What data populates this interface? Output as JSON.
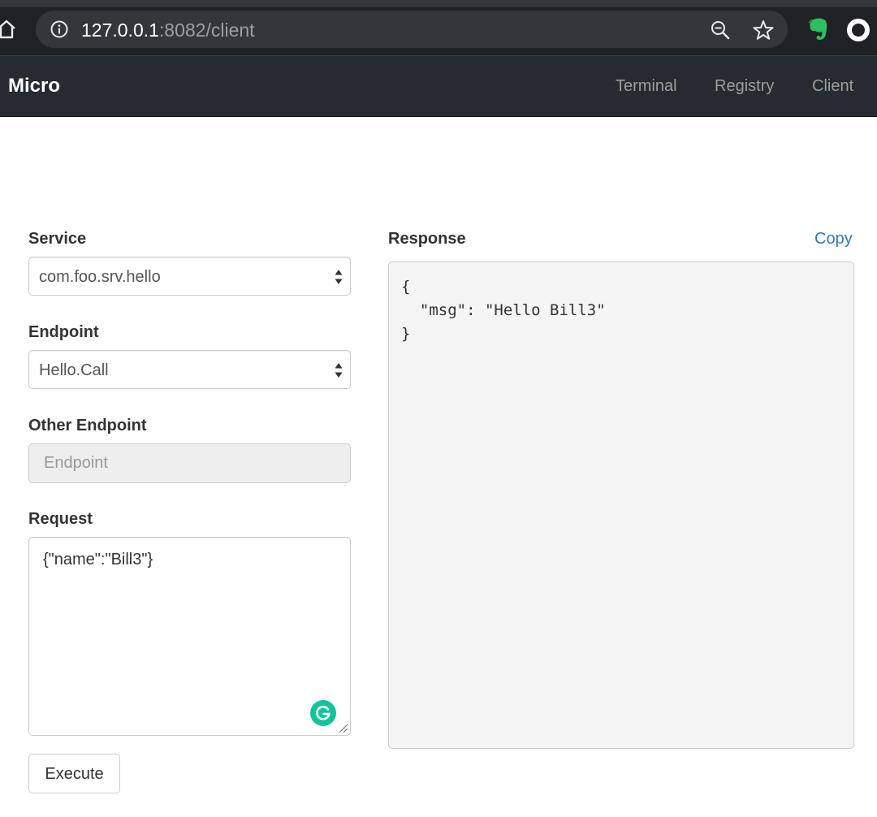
{
  "browser": {
    "url_host": "127.0.0.1",
    "url_rest": ":8082/client",
    "icons": [
      "home-icon",
      "info-icon",
      "zoom-out-icon",
      "star-icon",
      "evernote-icon",
      "opera-icon"
    ]
  },
  "navbar": {
    "brand": "Micro",
    "links": [
      "Terminal",
      "Registry",
      "Client"
    ],
    "bg_color": "#262a31"
  },
  "form": {
    "service_label": "Service",
    "service_value": "com.foo.srv.hello",
    "endpoint_label": "Endpoint",
    "endpoint_value": "Hello.Call",
    "other_endpoint_label": "Other Endpoint",
    "other_endpoint_placeholder": "Endpoint",
    "request_label": "Request",
    "request_value": "{\"name\":\"Bill3\"}",
    "execute_label": "Execute"
  },
  "response": {
    "label": "Response",
    "copy_label": "Copy",
    "body": "{\n  \"msg\": \"Hello Bill3\"\n}"
  },
  "colors": {
    "link": "#337ab7",
    "grammarly": "#15c39a"
  }
}
